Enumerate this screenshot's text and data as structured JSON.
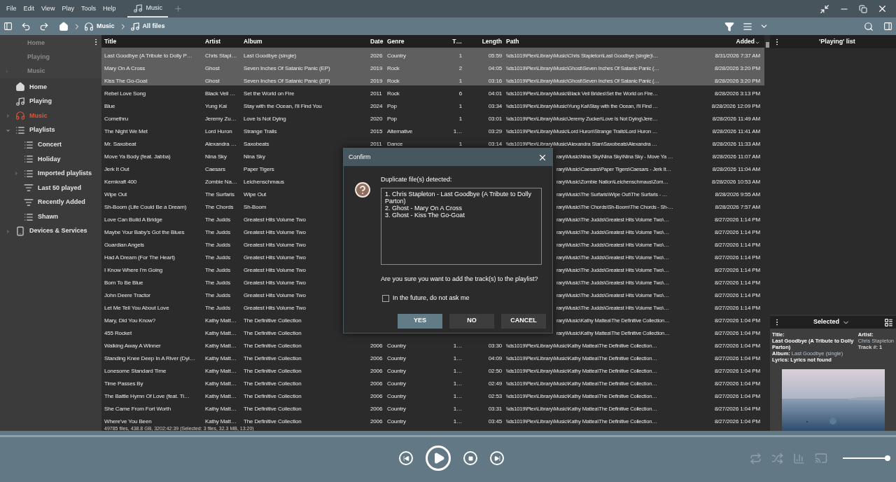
{
  "menu": [
    "File",
    "Edit",
    "View",
    "Play",
    "Tools",
    "Help"
  ],
  "tabs": [
    {
      "label": "Music",
      "selected": true
    }
  ],
  "breadcrumb": [
    {
      "label": "Music",
      "kind": "library"
    },
    {
      "label": "All files",
      "kind": "folder"
    }
  ],
  "sidebar": {
    "pinned": [
      {
        "label": "Home"
      },
      {
        "label": "Playing"
      },
      {
        "label": "Music",
        "expanded": false
      }
    ],
    "items": [
      {
        "label": "Home",
        "kind": "home",
        "selected": false
      },
      {
        "label": "Playing",
        "kind": "now_playing",
        "selected": false
      },
      {
        "label": "Music",
        "kind": "library",
        "selected": true,
        "expanded": false
      },
      {
        "label": "Playlists",
        "kind": "playlists",
        "selected": false,
        "expanded": true,
        "children": [
          {
            "label": "Concert",
            "kind": "playlist",
            "selected": false
          },
          {
            "label": "Holiday",
            "kind": "playlist",
            "selected": false
          },
          {
            "label": "Imported playlists",
            "kind": "playlist",
            "selected": false,
            "expanded": false
          },
          {
            "label": "Last 50 played",
            "kind": "auto_playlist",
            "selected": false
          },
          {
            "label": "Recently Added",
            "kind": "auto_playlist",
            "selected": false
          },
          {
            "label": "Shawn",
            "kind": "playlist",
            "selected": false
          }
        ]
      },
      {
        "label": "Devices & Services",
        "kind": "device",
        "selected": false,
        "expanded": false
      }
    ]
  },
  "table": {
    "columns": [
      {
        "label": "Title",
        "sorted": false
      },
      {
        "label": "Artist",
        "sorted": false
      },
      {
        "label": "Album",
        "sorted": false
      },
      {
        "label": "Date",
        "sorted": false
      },
      {
        "label": "Genre",
        "sorted": false
      },
      {
        "label": "T…",
        "sorted": false
      },
      {
        "label": "Length",
        "sorted": false
      },
      {
        "label": "Path",
        "sorted": false
      },
      {
        "label": "Added",
        "sorted": true
      }
    ],
    "rows": [
      {
        "kind": "full",
        "selected": true,
        "title": "Last Goodbye (A Tribute to Dolly P…",
        "artist": "Chris Stapl…",
        "album": "Last Goodbye (single)",
        "date": "2026",
        "genre": "Country",
        "track": "1",
        "length": "05:59",
        "path": "\\\\ds1019\\Plex\\Library\\Music\\Chris Stapleton\\Last Goodbye (single)\\…",
        "added": "8/31/2026 7:37 AM"
      },
      {
        "kind": "full",
        "selected": true,
        "title": "Mary On A Cross",
        "artist": "Ghost",
        "album": "Seven Inches Of Satanic Panic (EP)",
        "date": "2019",
        "genre": "Rock",
        "track": "2",
        "length": "04:05",
        "path": "\\\\ds1019\\Plex\\Library\\Music\\Ghost\\Seven Inches Of Satanic Panic (…",
        "added": "8/28/2026 3:20 PM"
      },
      {
        "kind": "full",
        "selected": true,
        "title": "Kiss The Go-Goat",
        "artist": "Ghost",
        "album": "Seven Inches Of Satanic Panic (EP)",
        "date": "2019",
        "genre": "Rock",
        "track": "1",
        "length": "03:16",
        "path": "\\\\ds1019\\Plex\\Library\\Music\\Ghost\\Seven Inches Of Satanic Panic (…",
        "added": "8/28/2026 3:20 PM"
      },
      {
        "kind": "full",
        "selected": false,
        "title": "Rebel Love Song",
        "artist": "Black Veil …",
        "album": "Set the World on Fire",
        "date": "2011",
        "genre": "Rock",
        "track": "6",
        "length": "04:01",
        "path": "\\\\ds1019\\Plex\\Library\\Music\\Black Veil Brides\\Set the World on Fire…",
        "added": "8/28/2026 3:13 PM"
      },
      {
        "kind": "full",
        "selected": false,
        "title": "Blue",
        "artist": "Yung Kai",
        "album": "Stay with the Ocean, I'll Find You",
        "date": "2024",
        "genre": "Pop",
        "track": "1",
        "length": "03:34",
        "path": "\\\\ds1019\\Plex\\Library\\Music\\Yung Kai\\Stay with the Ocean, I'll Find …",
        "added": "8/28/2026 12:09 PM"
      },
      {
        "kind": "full",
        "selected": false,
        "title": "Comethru",
        "artist": "Jeremy Zu…",
        "album": "Love Is Not Dying",
        "date": "2020",
        "genre": "Pop",
        "track": "1",
        "length": "03:01",
        "path": "\\\\ds1019\\Plex\\Library\\Music\\Jeremy Zucker\\Love Is Not Dying\\Jere…",
        "added": "8/28/2026 11:49 AM"
      },
      {
        "kind": "full",
        "selected": false,
        "title": "The Night We Met",
        "artist": "Lord Huron",
        "album": "Strange Trails",
        "date": "2015",
        "genre": "Alternative",
        "track": "1…",
        "length": "03:29",
        "path": "\\\\ds1019\\Plex\\Library\\Music\\Lord Huron\\Strange Trails\\Lord Huron …",
        "added": "8/28/2026 11:41 AM"
      },
      {
        "kind": "full",
        "selected": false,
        "title": "Mr. Saxobeat",
        "artist": "Alexandra …",
        "album": "Saxobeats",
        "date": "2011",
        "genre": "Dance",
        "track": "1",
        "length": "03:14",
        "path": "\\\\ds1019\\Plex\\Library\\Music\\Alexandra Stan\\Saxobeats\\Alexandra …",
        "added": "8/28/2026 11:33 AM"
      },
      {
        "kind": "covered",
        "selected": false,
        "title": "Move Ya Body (feat. Jabba)",
        "artist": "Nina Sky",
        "album": "Nina Sky",
        "path": "rary\\Music\\Nina Sky\\Nina Sky\\Nina Sky - Move Ya …",
        "added": "8/28/2026 11:07 AM"
      },
      {
        "kind": "covered",
        "selected": false,
        "title": "Jerk It Out",
        "artist": "Caesars",
        "album": "Paper Tigers",
        "path": "rary\\Music\\Caesars\\Paper Tigers\\Caesars - Jerk It…",
        "added": "8/28/2026 11:04 AM"
      },
      {
        "kind": "covered",
        "selected": false,
        "title": "Kernkraft 400",
        "artist": "Zombie Na…",
        "album": "Leichenschmaus",
        "path": "rary\\Music\\Zombie Nation\\Leichenschmaus\\Zom…",
        "added": "8/28/2026 10:53 AM"
      },
      {
        "kind": "covered",
        "selected": false,
        "title": "Wipe Out",
        "artist": "The Surfaris",
        "album": "Wipe Out",
        "path": "rary\\Music\\The Surfaris\\Wipe Out\\The Surfaris - …",
        "added": "8/28/2026 9:55 AM"
      },
      {
        "kind": "covered",
        "selected": false,
        "title": "Sh-Boom (Life Could Be a Dream)",
        "artist": "The Chords",
        "album": "Sh-Boom",
        "path": "rary\\Music\\The Chords\\Sh-Boom\\The Chords - Sh-…",
        "added": "8/28/2026 7:57 AM"
      },
      {
        "kind": "covered",
        "selected": false,
        "title": "Love Can Build A Bridge",
        "artist": "The Judds",
        "album": "Greatest Hits Volume Two",
        "path": "rary\\Music\\The Judds\\Greatest Hits Volume Two\\…",
        "added": "8/27/2026 1:14 PM"
      },
      {
        "kind": "covered",
        "selected": false,
        "title": "Maybe Your Baby's Got the Blues",
        "artist": "The Judds",
        "album": "Greatest Hits Volume Two",
        "path": "rary\\Music\\The Judds\\Greatest Hits Volume Two\\…",
        "added": "8/27/2026 1:14 PM"
      },
      {
        "kind": "covered",
        "selected": false,
        "title": "Guardian Angels",
        "artist": "The Judds",
        "album": "Greatest Hits Volume Two",
        "path": "rary\\Music\\The Judds\\Greatest Hits Volume Two\\…",
        "added": "8/27/2026 1:14 PM"
      },
      {
        "kind": "covered",
        "selected": false,
        "title": "Had A Dream (For The Heart)",
        "artist": "The Judds",
        "album": "Greatest Hits Volume Two",
        "path": "rary\\Music\\The Judds\\Greatest Hits Volume Two\\…",
        "added": "8/27/2026 1:14 PM"
      },
      {
        "kind": "covered",
        "selected": false,
        "title": "I Know Where I'm Going",
        "artist": "The Judds",
        "album": "Greatest Hits Volume Two",
        "path": "rary\\Music\\The Judds\\Greatest Hits Volume Two\\…",
        "added": "8/27/2026 1:14 PM"
      },
      {
        "kind": "covered",
        "selected": false,
        "title": "Born To Be Blue",
        "artist": "The Judds",
        "album": "Greatest Hits Volume Two",
        "path": "rary\\Music\\The Judds\\Greatest Hits Volume Two\\…",
        "added": "8/27/2026 1:14 PM"
      },
      {
        "kind": "covered",
        "selected": false,
        "title": "John Deere Tractor",
        "artist": "The Judds",
        "album": "Greatest Hits Volume Two",
        "path": "rary\\Music\\The Judds\\Greatest Hits Volume Two\\…",
        "added": "8/27/2026 1:14 PM"
      },
      {
        "kind": "covered",
        "selected": false,
        "title": "Let Me Tell You About Love",
        "artist": "The Judds",
        "album": "Greatest Hits Volume Two",
        "path": "rary\\Music\\The Judds\\Greatest Hits Volume Two\\…",
        "added": "8/27/2026 1:14 PM"
      },
      {
        "kind": "covered",
        "selected": false,
        "title": "Mary, Did You Know?",
        "artist": "Kathy Matt…",
        "album": "The Definitive Collection",
        "path": "rary\\Music\\Kathy Mattea\\The Definitive Collection…",
        "added": "8/27/2026 1:04 PM"
      },
      {
        "kind": "covered",
        "selected": false,
        "title": "455 Rocket",
        "artist": "Kathy Matt…",
        "album": "The Definitive Collection",
        "path": "rary\\Music\\Kathy Mattea\\The Definitive Collection…",
        "added": "8/27/2026 1:04 PM"
      },
      {
        "kind": "full",
        "selected": false,
        "title": "Walking Away A Winner",
        "artist": "Kathy Matt…",
        "album": "The Definitive Collection",
        "date": "2006",
        "genre": "Country",
        "track": "1…",
        "length": "03:30",
        "path": "\\\\ds1019\\Plex\\Library\\Music\\Kathy Mattea\\The Definitive Collection…",
        "added": "8/27/2026 1:04 PM"
      },
      {
        "kind": "full",
        "selected": false,
        "title": "Standing Knee Deep In A River (Dyi…",
        "artist": "Kathy Matt…",
        "album": "The Definitive Collection",
        "date": "2006",
        "genre": "Country",
        "track": "1…",
        "length": "04:09",
        "path": "\\\\ds1019\\Plex\\Library\\Music\\Kathy Mattea\\The Definitive Collection…",
        "added": "8/27/2026 1:04 PM"
      },
      {
        "kind": "full",
        "selected": false,
        "title": "Lonesome Standard Time",
        "artist": "Kathy Matt…",
        "album": "The Definitive Collection",
        "date": "2006",
        "genre": "Country",
        "track": "1…",
        "length": "02:50",
        "path": "\\\\ds1019\\Plex\\Library\\Music\\Kathy Mattea\\The Definitive Collection…",
        "added": "8/27/2026 1:04 PM"
      },
      {
        "kind": "full",
        "selected": false,
        "title": "Time Passes By",
        "artist": "Kathy Matt…",
        "album": "The Definitive Collection",
        "date": "2006",
        "genre": "Country",
        "track": "1…",
        "length": "02:49",
        "path": "\\\\ds1019\\Plex\\Library\\Music\\Kathy Mattea\\The Definitive Collection…",
        "added": "8/27/2026 1:04 PM"
      },
      {
        "kind": "full",
        "selected": false,
        "title": "The Battle Hymn Of Love (feat. Ti…",
        "artist": "Kathy Matt…",
        "album": "The Definitive Collection",
        "date": "2006",
        "genre": "Country",
        "track": "1…",
        "length": "02:53",
        "path": "\\\\ds1019\\Plex\\Library\\Music\\Kathy Mattea\\The Definitive Collection…",
        "added": "8/27/2026 1:04 PM"
      },
      {
        "kind": "full",
        "selected": false,
        "title": "She Came From Fort Worth",
        "artist": "Kathy Matt…",
        "album": "The Definitive Collection",
        "date": "2006",
        "genre": "Country",
        "track": "1…",
        "length": "03:31",
        "path": "\\\\ds1019\\Plex\\Library\\Music\\Kathy Mattea\\The Definitive Collection…",
        "added": "8/27/2026 1:04 PM"
      },
      {
        "kind": "full",
        "selected": false,
        "title": "Where've You Been",
        "artist": "Kathy Matt…",
        "album": "The Definitive Collection",
        "date": "2006",
        "genre": "Country",
        "track": "1…",
        "length": "03:45",
        "path": "\\\\ds1019\\Plex\\Library\\Music\\Kathy Mattea\\The Definitive Collection…",
        "added": "8/27/2026 1:04 PM"
      }
    ]
  },
  "status_bar": "49785 files, 438.8 GB, 3202:42:39 (Selected: 3 files, 32.3 MB, 13:20)",
  "playing_panel": {
    "title": "'Playing' list"
  },
  "selected_panel": {
    "title": "Selected",
    "title_label": "Title:",
    "title_value": "Last Goodbye (A Tribute to Dolly Parton)",
    "album_label": "Album:",
    "album_value": "Last Goodbye (single)",
    "lyrics_label": "Lyrics:",
    "lyrics_value": "Lyrics not found",
    "artist_label": "Artist:",
    "artist_value": "Chris Stapleton",
    "track_label": "Track #:",
    "track_value": "1"
  },
  "dialog": {
    "title": "Confirm",
    "heading": "Duplicate file(s) detected:",
    "items": [
      "1. Chris Stapleton - Last Goodbye (A Tribute to Dolly Parton)",
      "2. Ghost - Mary On A Cross",
      "3. Ghost - Kiss The Go-Goat"
    ],
    "question": "Are you sure you want to add the track(s) to the playlist?",
    "checkbox": {
      "label": "In the future, do not ask me",
      "checked": false
    },
    "buttons": [
      {
        "label": "YES",
        "primary": true
      },
      {
        "label": "NO",
        "primary": false
      },
      {
        "label": "CANCEL",
        "primary": false
      }
    ]
  },
  "player": {
    "volume": {
      "level": 1
    }
  }
}
